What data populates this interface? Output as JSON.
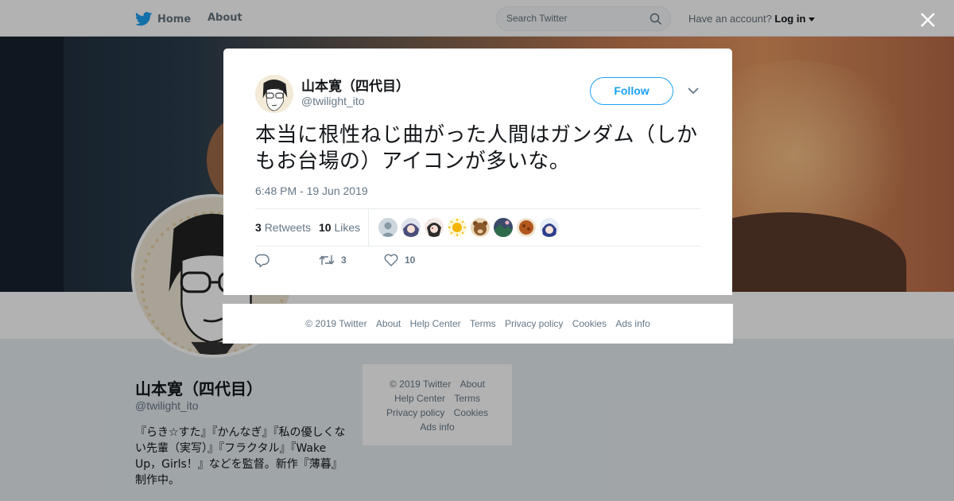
{
  "nav": {
    "home_label": "Home",
    "about_label": "About",
    "search_placeholder": "Search Twitter",
    "account_text": "Have an account?",
    "login_label": "Log in"
  },
  "profile": {
    "name": "山本寛（四代目）",
    "handle": "@twilight_ito",
    "bio": "『らき☆すた』『かんなぎ』『私の優しくない先輩（実写）』『フラクタル』『Wake Up，Girls！』などを監督。新作『薄暮』制作中。"
  },
  "side_footer": {
    "links": [
      "© 2019 Twitter",
      "About",
      "Help Center",
      "Terms",
      "Privacy policy",
      "Cookies",
      "Ads info"
    ]
  },
  "tweet": {
    "name": "山本寛（四代目）",
    "handle": "@twilight_ito",
    "follow_label": "Follow",
    "text": "本当に根性ねじ曲がった人間はガンダム（しかもお台場の）アイコンが多いな。",
    "timestamp": "6:48 PM - 19 Jun 2019",
    "retweets_count": "3",
    "retweets_label": "Retweets",
    "likes_count": "10",
    "likes_label": "Likes",
    "action_retweet_count": "3",
    "action_like_count": "10",
    "likers": [
      "default-avatar",
      "anime-girl-avatar",
      "anime-face-avatar",
      "sun-avatar",
      "bear-avatar",
      "landscape-avatar",
      "food-avatar",
      "blue-hair-avatar"
    ]
  },
  "modal_footer": {
    "links": [
      "© 2019 Twitter",
      "About",
      "Help Center",
      "Terms",
      "Privacy policy",
      "Cookies",
      "Ads info"
    ]
  },
  "colors": {
    "brand": "#1da1f2",
    "text_primary": "#14171a",
    "text_secondary": "#657786",
    "border": "#e6ecf0"
  }
}
